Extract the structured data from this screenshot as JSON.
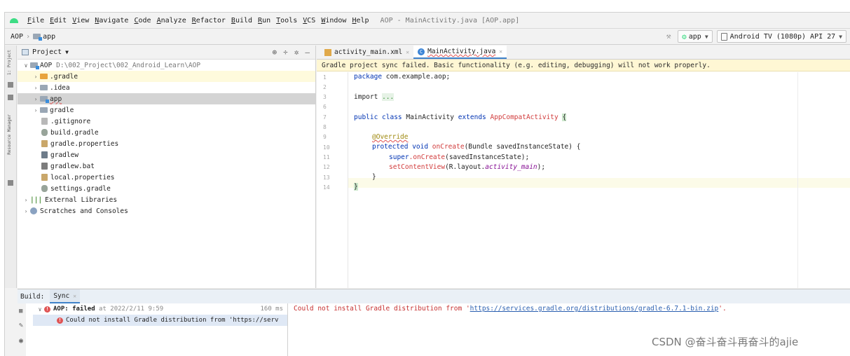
{
  "menubar": {
    "items": [
      "File",
      "Edit",
      "View",
      "Navigate",
      "Code",
      "Analyze",
      "Refactor",
      "Build",
      "Run",
      "Tools",
      "VCS",
      "Window",
      "Help"
    ],
    "title": "AOP - MainActivity.java [AOP.app]"
  },
  "navbar": {
    "root": "AOP",
    "module": "app",
    "run_config": "app",
    "device": "Android TV (1080p) API 27"
  },
  "sidestrip": {
    "project_tab": "1: Project",
    "resource_tab": "Resource Manager"
  },
  "project": {
    "header": "Project",
    "tree": [
      {
        "name": "AOP",
        "path": "D:\\002_Project\\002_Android_Learn\\AOP"
      },
      {
        "name": ".gradle"
      },
      {
        "name": ".idea"
      },
      {
        "name": "app"
      },
      {
        "name": "gradle"
      },
      {
        "name": ".gitignore"
      },
      {
        "name": "build.gradle"
      },
      {
        "name": "gradle.properties"
      },
      {
        "name": "gradlew"
      },
      {
        "name": "gradlew.bat"
      },
      {
        "name": "local.properties"
      },
      {
        "name": "settings.gradle"
      },
      {
        "name": "External Libraries"
      },
      {
        "name": "Scratches and Consoles"
      }
    ]
  },
  "editor": {
    "tabs": [
      "activity_main.xml",
      "MainActivity.java"
    ],
    "banner": "Gradle project sync failed. Basic functionality (e.g. editing, debugging) will not work properly.",
    "line_numbers": [
      "1",
      "2",
      "3",
      "6",
      "7",
      "8",
      "9",
      "10",
      "11",
      "12",
      "13",
      "14"
    ],
    "code": {
      "l1_kw": "package",
      "l1_rest": " com.example.aop;",
      "l3_kw": "import",
      "l3_fold": "...",
      "l7_a": "public class",
      "l7_b": " MainActivity ",
      "l7_c": "extends",
      "l7_d": " AppCompatActivity",
      "l7_e": "{",
      "l9": "@Override",
      "l10_a": "protected void",
      "l10_b": " onCreate",
      "l10_c": "(Bundle savedInstanceState) {",
      "l11_a": "super",
      "l11_b": ".onCreate",
      "l11_c": "(savedInstanceState);",
      "l12_a": "setContentView",
      "l12_b": "(R.layout.",
      "l12_c": "activity_main",
      "l12_d": ");",
      "l13": "}",
      "l14": "}"
    }
  },
  "build": {
    "label": "Build:",
    "tab": "Sync",
    "row1_name": "AOP:",
    "row1_status": "failed",
    "row1_time": "at 2022/2/11 9:59",
    "row1_duration": "160 ms",
    "row2": "Could not install Gradle distribution from 'https://serv",
    "message_pre": "Could not install Gradle distribution from '",
    "message_link": "https://services.gradle.org/distributions/gradle-6.7.1-bin.zip",
    "message_post": "'."
  },
  "watermark": "CSDN @奋斗奋斗再奋斗的ajie"
}
